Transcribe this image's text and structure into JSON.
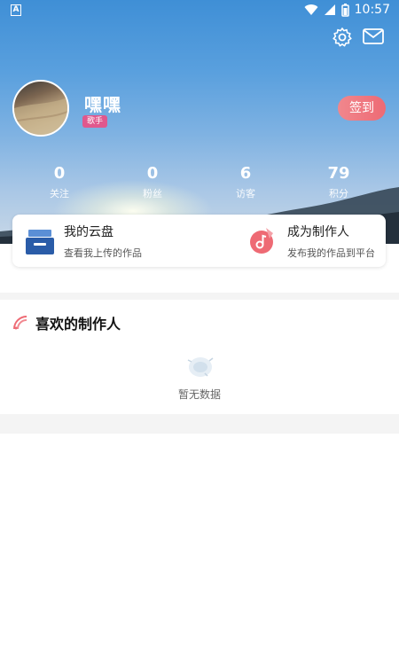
{
  "status_bar": {
    "badge": "A",
    "time": "10:57"
  },
  "header": {
    "icons": [
      "settings-icon",
      "mail-icon"
    ]
  },
  "profile": {
    "username": "嘿嘿",
    "role": "歌手",
    "signin_label": "签到"
  },
  "stats": [
    {
      "value": "0",
      "label": "关注"
    },
    {
      "value": "0",
      "label": "粉丝"
    },
    {
      "value": "6",
      "label": "访客"
    },
    {
      "value": "79",
      "label": "积分"
    }
  ],
  "card": {
    "cloud": {
      "title": "我的云盘",
      "subtitle": "查看我上传的作品"
    },
    "creator": {
      "title": "成为制作人",
      "subtitle": "发布我的作品到平台"
    }
  },
  "favorites": {
    "title": "喜欢的制作人",
    "empty_text": "暂无数据"
  },
  "colors": {
    "accent": "#ee6a74",
    "badge": "#e0588d",
    "cloud_icon": "#2a5ca8"
  }
}
